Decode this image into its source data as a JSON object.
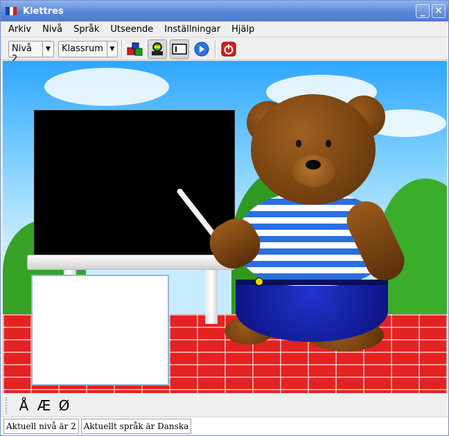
{
  "window": {
    "title": "Klettres",
    "minimize_glyph": "_",
    "close_glyph": "✕"
  },
  "menu": {
    "items": [
      "Arkiv",
      "Nivå",
      "Språk",
      "Utseende",
      "Inställningar",
      "Hjälp"
    ]
  },
  "toolbar": {
    "level_combo": "Nivå 2",
    "theme_combo": "Klassrum",
    "icons": [
      "blocks-icon",
      "grownup-icon",
      "letter-box-icon",
      "next-arrow-icon",
      "quit-icon"
    ],
    "accent_blue": "#2a74e0",
    "quit_red": "#d62020"
  },
  "special_chars": [
    "Å",
    "Æ",
    "Ø"
  ],
  "status": {
    "level": "Aktuell nivå är 2",
    "language": "Aktuellt språk är Danska"
  }
}
